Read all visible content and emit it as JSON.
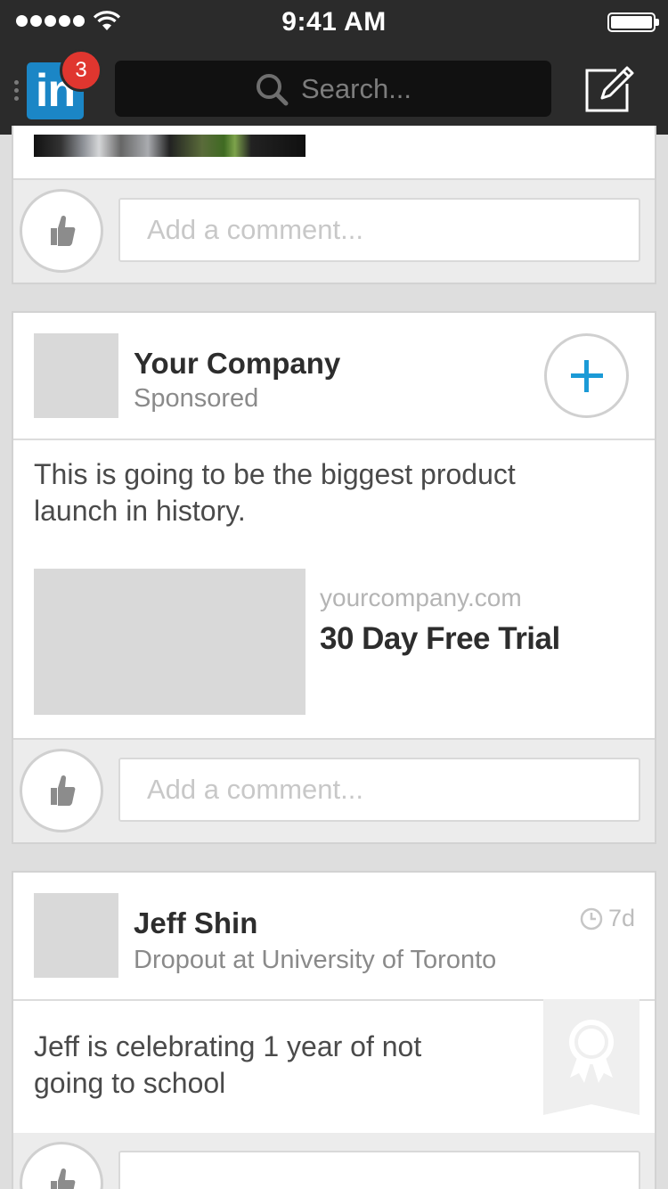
{
  "status_bar": {
    "time": "9:41 AM"
  },
  "nav": {
    "badge_count": "3",
    "logo_text": "in",
    "search_placeholder": "Search..."
  },
  "feed": {
    "post1": {
      "comment_placeholder": "Add a comment..."
    },
    "sponsored_post": {
      "company_name": "Your Company",
      "label": "Sponsored",
      "text": "This is going to be the biggest product launch in history.",
      "link_domain": "yourcompany.com",
      "link_title": "30 Day Free Trial",
      "comment_placeholder": "Add a comment..."
    },
    "post3": {
      "author_name": "Jeff Shin",
      "headline": "Dropout at University of Toronto",
      "time_ago": "7d",
      "text": "Jeff is celebrating 1 year of not going to school"
    }
  }
}
